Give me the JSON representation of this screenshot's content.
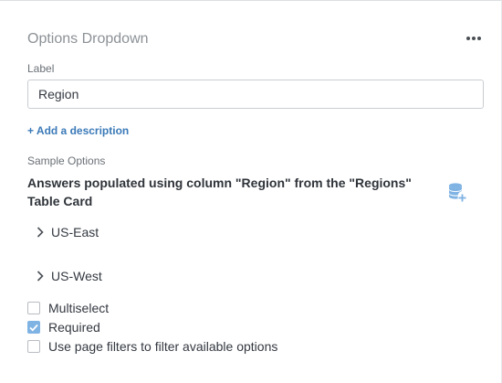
{
  "panel": {
    "title": "Options Dropdown",
    "more_icon": "more-horizontal-icon"
  },
  "label_field": {
    "label": "Label",
    "value": "Region"
  },
  "add_description": {
    "label": "+ Add a description"
  },
  "sample_options": {
    "label": "Sample Options",
    "source_text": "Answers populated using column \"Region\" from the \"Regions\" Table Card",
    "source_icon": "database-add-icon",
    "options": [
      {
        "label": "US-East",
        "icon": "chevron-right-icon"
      },
      {
        "label": "US-West",
        "icon": "chevron-right-icon"
      }
    ]
  },
  "settings": [
    {
      "label": "Multiselect",
      "checked": false
    },
    {
      "label": "Required",
      "checked": true
    },
    {
      "label": "Use page filters to filter available options",
      "checked": false
    }
  ],
  "colors": {
    "accent": "#3b7ab8",
    "checkbox_checked": "#7fb3e3",
    "title_muted": "#8c9196"
  }
}
